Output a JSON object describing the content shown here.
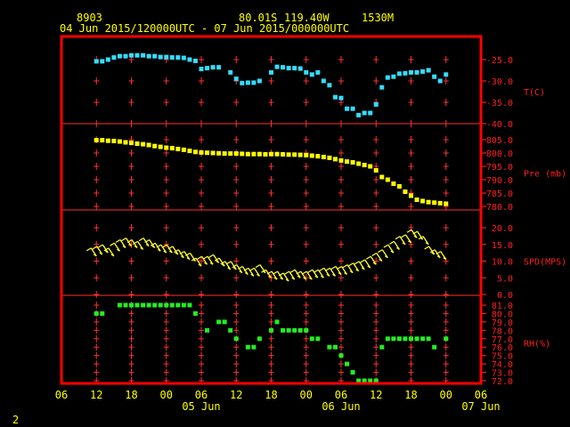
{
  "header": {
    "station": "8903",
    "lat": "80.01S",
    "lon": "119.40W",
    "elev": "1530M",
    "period": "04 Jun 2015/120000UTC - 07 Jun 2015/000000UTC"
  },
  "footer": {
    "page": "2"
  },
  "colors": {
    "frame": "#ff0000",
    "grid": "#ff3030",
    "labels": "#ff3030",
    "text": "#ffff00",
    "temp": "#33ddff",
    "pressure": "#ffff00",
    "wind": "#ffff33",
    "rh": "#22ee22"
  },
  "x_axis": {
    "ticks": [
      "06",
      "12",
      "18",
      "00",
      "06",
      "12",
      "18",
      "00",
      "06",
      "12",
      "18",
      "00",
      "06"
    ],
    "day_labels": [
      "05 Jun",
      "06 Jun",
      "07 Jun"
    ]
  },
  "chart_data": [
    {
      "type": "scatter",
      "panel": "temperature",
      "ylabel": "T(C)",
      "yticks": [
        "-25.0",
        "-30.0",
        "-35.0",
        "-40.0"
      ],
      "ylim": [
        -40.5,
        -20.5
      ],
      "x_hours": [
        12,
        13,
        14,
        15,
        16,
        17,
        18,
        19,
        20,
        21,
        22,
        23,
        24,
        25,
        26,
        27,
        28,
        29,
        30,
        31,
        32,
        33,
        34,
        35,
        36,
        37,
        38,
        39,
        40,
        41,
        42,
        43,
        44,
        45,
        46,
        47,
        48,
        49,
        50,
        51,
        52,
        53,
        54,
        55,
        56,
        57,
        58,
        59,
        60,
        61,
        62,
        63,
        64,
        65,
        66,
        67,
        68,
        69,
        70,
        71,
        72
      ],
      "x": [
        "04 Jun 12",
        "04 Jun 13",
        "04 Jun 14",
        "04 Jun 15",
        "04 Jun 16",
        "04 Jun 17",
        "04 Jun 18",
        "04 Jun 19",
        "04 Jun 20",
        "04 Jun 21",
        "04 Jun 22",
        "04 Jun 23",
        "05 Jun 00",
        "05 Jun 01",
        "05 Jun 02",
        "05 Jun 03",
        "05 Jun 04",
        "05 Jun 05",
        "05 Jun 06",
        "05 Jun 07",
        "05 Jun 08",
        "05 Jun 09",
        "05 Jun 10",
        "05 Jun 11",
        "05 Jun 12",
        "05 Jun 13",
        "05 Jun 14",
        "05 Jun 15",
        "05 Jun 16",
        "05 Jun 17",
        "05 Jun 18",
        "05 Jun 19",
        "05 Jun 20",
        "05 Jun 21",
        "05 Jun 22",
        "05 Jun 23",
        "06 Jun 00",
        "06 Jun 01",
        "06 Jun 02",
        "06 Jun 03",
        "06 Jun 04",
        "06 Jun 05",
        "06 Jun 06",
        "06 Jun 07",
        "06 Jun 08",
        "06 Jun 09",
        "06 Jun 10",
        "06 Jun 11",
        "06 Jun 12",
        "06 Jun 13",
        "06 Jun 14",
        "06 Jun 15",
        "06 Jun 16",
        "06 Jun 17",
        "06 Jun 18",
        "06 Jun 19",
        "06 Jun 20",
        "06 Jun 21",
        "06 Jun 22",
        "06 Jun 23",
        "07 Jun 00"
      ],
      "values": [
        -25.4,
        -25.4,
        -25.0,
        -24.5,
        -24.2,
        -24.2,
        -24.0,
        -24.0,
        -24.0,
        -24.2,
        -24.2,
        -24.4,
        -24.4,
        -24.5,
        -24.5,
        -24.6,
        -25.0,
        -25.3,
        -27.2,
        -27.0,
        -26.8,
        -26.8,
        null,
        -28.0,
        -29.5,
        -30.5,
        -30.4,
        -30.4,
        -30.0,
        null,
        -28.0,
        -26.7,
        -26.8,
        -27.0,
        -27.0,
        -27.1,
        -28.0,
        -28.5,
        -28.0,
        -30.0,
        -31.0,
        -33.8,
        -34.0,
        -36.5,
        -36.5,
        -38.0,
        -37.5,
        -37.5,
        -35.5,
        -31.5,
        -29.2,
        -29.0,
        -28.3,
        -28.2,
        -28.0,
        -28.0,
        -27.8,
        -27.5,
        -29.0,
        -30.0,
        -28.5
      ]
    },
    {
      "type": "scatter",
      "panel": "pressure",
      "ylabel": "Pre (mb)",
      "yticks": [
        "805.0",
        "800.0",
        "795.0",
        "790.0",
        "785.0",
        "780.0"
      ],
      "ylim": [
        780.5,
        810
      ],
      "x_hours": [
        12,
        13,
        14,
        15,
        16,
        17,
        18,
        19,
        20,
        21,
        22,
        23,
        24,
        25,
        26,
        27,
        28,
        29,
        30,
        31,
        32,
        33,
        34,
        35,
        36,
        37,
        38,
        39,
        40,
        41,
        42,
        43,
        44,
        45,
        46,
        47,
        48,
        49,
        50,
        51,
        52,
        53,
        54,
        55,
        56,
        57,
        58,
        59,
        60,
        61,
        62,
        63,
        64,
        65,
        66,
        67,
        68,
        69,
        70,
        71,
        72
      ],
      "x": [
        "04 Jun 12",
        "04 Jun 13",
        "04 Jun 14",
        "04 Jun 15",
        "04 Jun 16",
        "04 Jun 17",
        "04 Jun 18",
        "04 Jun 19",
        "04 Jun 20",
        "04 Jun 21",
        "04 Jun 22",
        "04 Jun 23",
        "05 Jun 00",
        "05 Jun 01",
        "05 Jun 02",
        "05 Jun 03",
        "05 Jun 04",
        "05 Jun 05",
        "05 Jun 06",
        "05 Jun 07",
        "05 Jun 08",
        "05 Jun 09",
        "05 Jun 10",
        "05 Jun 11",
        "05 Jun 12",
        "05 Jun 13",
        "05 Jun 14",
        "05 Jun 15",
        "05 Jun 16",
        "05 Jun 17",
        "05 Jun 18",
        "05 Jun 19",
        "05 Jun 20",
        "05 Jun 21",
        "05 Jun 22",
        "05 Jun 23",
        "06 Jun 00",
        "06 Jun 01",
        "06 Jun 02",
        "06 Jun 03",
        "06 Jun 04",
        "06 Jun 05",
        "06 Jun 06",
        "06 Jun 07",
        "06 Jun 08",
        "06 Jun 09",
        "06 Jun 10",
        "06 Jun 11",
        "06 Jun 12",
        "06 Jun 13",
        "06 Jun 14",
        "06 Jun 15",
        "06 Jun 16",
        "06 Jun 17",
        "06 Jun 18",
        "06 Jun 19",
        "06 Jun 20",
        "06 Jun 21",
        "06 Jun 22",
        "06 Jun 23",
        "07 Jun 00"
      ],
      "values": [
        804.8,
        804.8,
        804.6,
        804.5,
        804.3,
        804.0,
        803.8,
        803.5,
        803.3,
        803.0,
        802.6,
        802.3,
        802.0,
        801.8,
        801.5,
        801.2,
        800.8,
        800.4,
        800.2,
        800.1,
        800.0,
        799.9,
        799.8,
        799.8,
        799.8,
        799.7,
        799.6,
        799.6,
        799.6,
        799.5,
        799.6,
        799.6,
        799.5,
        799.4,
        799.4,
        799.3,
        799.2,
        799.0,
        798.8,
        798.5,
        798.2,
        797.7,
        797.2,
        796.8,
        796.5,
        796.0,
        795.5,
        795.0,
        793.5,
        791.0,
        790.0,
        788.5,
        787.5,
        785.5,
        784.0,
        782.5,
        782.0,
        781.6,
        781.4,
        781.2,
        781.0
      ]
    },
    {
      "type": "scatter",
      "panel": "wind",
      "ylabel": "SPD(MPS)",
      "yticks": [
        "20.0",
        "15.0",
        "10.0",
        "5.0",
        "0.0"
      ],
      "ylim": [
        0,
        20
      ],
      "x_hours": [
        12,
        13,
        14,
        15,
        16,
        17,
        18,
        19,
        20,
        21,
        22,
        23,
        24,
        25,
        26,
        27,
        28,
        29,
        30,
        31,
        32,
        33,
        34,
        35,
        36,
        37,
        38,
        39,
        40,
        41,
        42,
        43,
        44,
        45,
        46,
        47,
        48,
        49,
        50,
        51,
        52,
        53,
        54,
        55,
        56,
        57,
        58,
        59,
        60,
        61,
        62,
        63,
        64,
        65,
        66,
        67,
        68,
        69,
        70,
        71,
        72
      ],
      "x": [
        "04 Jun 12",
        "04 Jun 13",
        "04 Jun 14",
        "04 Jun 15",
        "04 Jun 16",
        "04 Jun 17",
        "04 Jun 18",
        "04 Jun 19",
        "04 Jun 20",
        "04 Jun 21",
        "04 Jun 22",
        "04 Jun 23",
        "05 Jun 00",
        "05 Jun 01",
        "05 Jun 02",
        "05 Jun 03",
        "05 Jun 04",
        "05 Jun 05",
        "05 Jun 06",
        "05 Jun 07",
        "05 Jun 08",
        "05 Jun 09",
        "05 Jun 10",
        "05 Jun 11",
        "05 Jun 12",
        "05 Jun 13",
        "05 Jun 14",
        "05 Jun 15",
        "05 Jun 16",
        "05 Jun 17",
        "05 Jun 18",
        "05 Jun 19",
        "05 Jun 20",
        "05 Jun 21",
        "05 Jun 22",
        "05 Jun 23",
        "06 Jun 00",
        "06 Jun 01",
        "06 Jun 02",
        "06 Jun 03",
        "06 Jun 04",
        "06 Jun 05",
        "06 Jun 06",
        "06 Jun 07",
        "06 Jun 08",
        "06 Jun 09",
        "06 Jun 10",
        "06 Jun 11",
        "06 Jun 12",
        "06 Jun 13",
        "06 Jun 14",
        "06 Jun 15",
        "06 Jun 16",
        "06 Jun 17",
        "06 Jun 18",
        "06 Jun 19",
        "06 Jun 20",
        "06 Jun 21",
        "06 Jun 22",
        "06 Jun 23",
        "07 Jun 00"
      ],
      "values": [
        11.5,
        12.0,
        12.5,
        11.5,
        13.0,
        14.0,
        14.5,
        14.0,
        13.5,
        14.5,
        14.0,
        13.0,
        12.5,
        12.5,
        12.0,
        11.0,
        10.5,
        10.0,
        8.5,
        9.0,
        9.0,
        9.5,
        8.5,
        7.5,
        7.5,
        6.5,
        6.0,
        5.5,
        5.5,
        6.5,
        5.0,
        4.5,
        4.5,
        4.0,
        4.5,
        5.0,
        4.5,
        4.5,
        5.0,
        5.0,
        5.5,
        5.5,
        6.0,
        6.0,
        6.5,
        7.0,
        7.5,
        8.0,
        9.0,
        10.0,
        11.0,
        12.5,
        13.5,
        15.0,
        15.5,
        17.0,
        16.5,
        15.0,
        12.0,
        11.0,
        10.5
      ]
    },
    {
      "type": "scatter",
      "panel": "relative-humidity",
      "ylabel": "RH(%)",
      "yticks": [
        "81.0",
        "80.0",
        "79.0",
        "78.0",
        "77.0",
        "76.0",
        "75.0",
        "74.0",
        "73.0",
        "72.0"
      ],
      "ylim": [
        72,
        81
      ],
      "x_hours": [
        12,
        13,
        14,
        15,
        16,
        17,
        18,
        19,
        20,
        21,
        22,
        23,
        24,
        25,
        26,
        27,
        28,
        29,
        30,
        31,
        32,
        33,
        34,
        35,
        36,
        37,
        38,
        39,
        40,
        41,
        42,
        43,
        44,
        45,
        46,
        47,
        48,
        49,
        50,
        51,
        52,
        53,
        54,
        55,
        56,
        57,
        58,
        59,
        60,
        61,
        62,
        63,
        64,
        65,
        66,
        67,
        68,
        69,
        70,
        71,
        72
      ],
      "x": [
        "04 Jun 12",
        "04 Jun 13",
        "04 Jun 14",
        "04 Jun 15",
        "04 Jun 16",
        "04 Jun 17",
        "04 Jun 18",
        "04 Jun 19",
        "04 Jun 20",
        "04 Jun 21",
        "04 Jun 22",
        "04 Jun 23",
        "05 Jun 00",
        "05 Jun 01",
        "05 Jun 02",
        "05 Jun 03",
        "05 Jun 04",
        "05 Jun 05",
        "05 Jun 06",
        "05 Jun 07",
        "05 Jun 08",
        "05 Jun 09",
        "05 Jun 10",
        "05 Jun 11",
        "05 Jun 12",
        "05 Jun 13",
        "05 Jun 14",
        "05 Jun 15",
        "05 Jun 16",
        "05 Jun 17",
        "05 Jun 18",
        "05 Jun 19",
        "05 Jun 20",
        "05 Jun 21",
        "05 Jun 22",
        "05 Jun 23",
        "06 Jun 00",
        "06 Jun 01",
        "06 Jun 02",
        "06 Jun 03",
        "06 Jun 04",
        "06 Jun 05",
        "06 Jun 06",
        "06 Jun 07",
        "06 Jun 08",
        "06 Jun 09",
        "06 Jun 10",
        "06 Jun 11",
        "06 Jun 12",
        "06 Jun 13",
        "06 Jun 14",
        "06 Jun 15",
        "06 Jun 16",
        "06 Jun 17",
        "06 Jun 18",
        "06 Jun 19",
        "06 Jun 20",
        "06 Jun 21",
        "06 Jun 22",
        "06 Jun 23",
        "07 Jun 00"
      ],
      "values": [
        80,
        80,
        null,
        null,
        81,
        81,
        81,
        81,
        81,
        81,
        81,
        81,
        81,
        81,
        81,
        81,
        81,
        80,
        null,
        78,
        null,
        79,
        79,
        78,
        77,
        null,
        76,
        76,
        77,
        null,
        78,
        79,
        78,
        78,
        78,
        78,
        78,
        77,
        77,
        null,
        76,
        76,
        75,
        74,
        73,
        72,
        72,
        72,
        72,
        76,
        77,
        77,
        77,
        77,
        77,
        77,
        77,
        77,
        76,
        null,
        77
      ]
    }
  ]
}
